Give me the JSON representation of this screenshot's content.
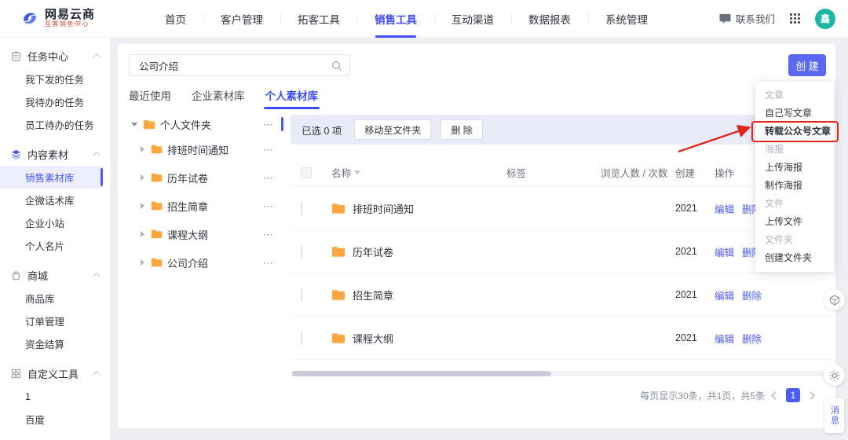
{
  "topbar": {
    "logo": {
      "title": "网易云商",
      "subtitle": "互客销售中心"
    },
    "nav": [
      "首页",
      "客户管理",
      "拓客工具",
      "销售工具",
      "互动渠道",
      "数据报表",
      "系统管理"
    ],
    "contact_label": "联系我们",
    "avatar": "鑫"
  },
  "sidebar": {
    "sections": [
      {
        "title": "任务中心",
        "items": [
          "我下发的任务",
          "我待办的任务",
          "员工待办的任务"
        ]
      },
      {
        "title": "内容素材",
        "items": [
          "销售素材库",
          "企微话术库",
          "企业小站",
          "个人名片"
        ]
      },
      {
        "title": "商城",
        "items": [
          "商品库",
          "订单管理",
          "资金结算"
        ]
      },
      {
        "title": "自定义工具",
        "items": [
          "1",
          "百度"
        ]
      }
    ],
    "active_item": "销售素材库"
  },
  "main": {
    "search_value": "公司介绍",
    "create_label": "创 建",
    "tabs": [
      "最近使用",
      "企业素材库",
      "个人素材库"
    ],
    "active_tab": "个人素材库",
    "tree": {
      "root": "个人文件夹",
      "children": [
        "排班时间通知",
        "历年试卷",
        "招生简章",
        "课程大纲",
        "公司介绍"
      ]
    },
    "toolbar": {
      "selected": "已选 0 项",
      "move": "移动至文件夹",
      "delete": "删 除"
    },
    "table": {
      "headers": {
        "name": "名称",
        "tag": "标签",
        "views": "浏览人数 / 次数",
        "created": "创建",
        "actions": "操作"
      },
      "rows": [
        {
          "name": "排班时间通知",
          "created": "2021",
          "edit": "编辑",
          "remove": "删除"
        },
        {
          "name": "历年试卷",
          "created": "2021",
          "edit": "编辑",
          "remove": "删除"
        },
        {
          "name": "招生简章",
          "created": "2021",
          "edit": "编辑",
          "remove": "删除"
        },
        {
          "name": "课程大纲",
          "created": "2021",
          "edit": "编辑",
          "remove": "删除"
        }
      ]
    },
    "pagination": {
      "summary": "每页显示30条，共1页，共5条",
      "page": "1"
    },
    "menu": [
      {
        "label": "文章",
        "type": "group"
      },
      {
        "label": "自己写文章",
        "type": "item"
      },
      {
        "label": "转载公众号文章",
        "type": "item",
        "annotated": true
      },
      {
        "label": "海报",
        "type": "group"
      },
      {
        "label": "上传海报",
        "type": "item"
      },
      {
        "label": "制作海报",
        "type": "item"
      },
      {
        "label": "文件",
        "type": "group"
      },
      {
        "label": "上传文件",
        "type": "item"
      },
      {
        "label": "文件夹",
        "type": "group"
      },
      {
        "label": "创建文件夹",
        "type": "item"
      }
    ]
  },
  "floating": {
    "message": "消息"
  },
  "colors": {
    "primary": "#4b5bf5",
    "annotation": "#e1251b",
    "folder": "#ffa63e",
    "avatar_bg": "#1db5a5",
    "bulk_bar_bg": "#e9ebf9"
  }
}
